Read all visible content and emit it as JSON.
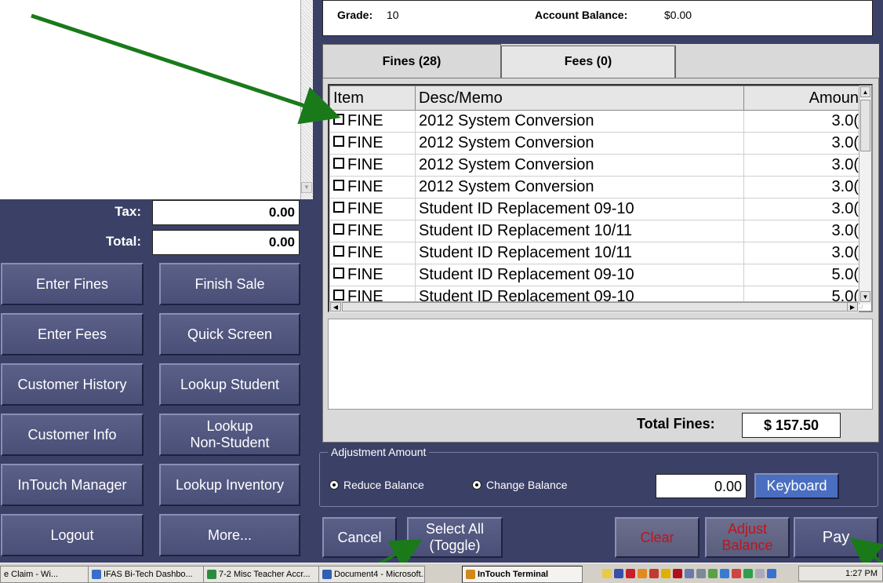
{
  "student_info": {
    "grade_label": "Grade:",
    "grade_value": "10",
    "balance_label": "Account Balance:",
    "balance_value": "$0.00"
  },
  "summary": {
    "tax_label": "Tax:",
    "tax_value": "0.00",
    "total_label": "Total:",
    "total_value": "0.00"
  },
  "left_buttons": {
    "enter_fines": "Enter Fines",
    "finish_sale": "Finish Sale",
    "enter_fees": "Enter Fees",
    "quick_screen": "Quick Screen",
    "customer_history": "Customer History",
    "lookup_student": "Lookup Student",
    "customer_info": "Customer Info",
    "lookup_non_student_1": "Lookup",
    "lookup_non_student_2": "Non-Student",
    "intouch_manager": "InTouch Manager",
    "lookup_inventory": "Lookup Inventory",
    "logout": "Logout",
    "more": "More..."
  },
  "tabs": [
    {
      "label": "Fines (28)",
      "active": true
    },
    {
      "label": "Fees (0)",
      "active": false
    }
  ],
  "grid": {
    "columns": [
      "Item",
      "Desc/Memo",
      "Amoun"
    ],
    "rows": [
      {
        "item": "FINE",
        "desc": "2012 System Conversion",
        "amount": "3.0("
      },
      {
        "item": "FINE",
        "desc": "2012 System Conversion",
        "amount": "3.0("
      },
      {
        "item": "FINE",
        "desc": "2012 System Conversion",
        "amount": "3.0("
      },
      {
        "item": "FINE",
        "desc": "2012 System Conversion",
        "amount": "3.0("
      },
      {
        "item": "FINE",
        "desc": "Student ID Replacement 09-10",
        "amount": "3.0("
      },
      {
        "item": "FINE",
        "desc": "Student ID Replacement 10/11",
        "amount": "3.0("
      },
      {
        "item": "FINE",
        "desc": "Student ID Replacement 10/11",
        "amount": "3.0("
      },
      {
        "item": "FINE",
        "desc": "Student ID Replacement 09-10",
        "amount": "5.0("
      },
      {
        "item": "FINE",
        "desc": "Student ID Replacement 09-10",
        "amount": "5.0("
      }
    ]
  },
  "totals": {
    "total_fines_label": "Total Fines:",
    "total_fines_value": "$ 157.50"
  },
  "adjustment": {
    "legend": "Adjustment Amount",
    "reduce_label": "Reduce Balance",
    "change_label": "Change Balance",
    "amount_value": "0.00",
    "keyboard_label": "Keyboard"
  },
  "bottom_buttons": {
    "cancel": "Cancel",
    "select_all_1": "Select All",
    "select_all_2": "(Toggle)",
    "clear": "Clear",
    "adjust_1": "Adjust",
    "adjust_2": "Balance",
    "pay": "Pay"
  },
  "taskbar": {
    "tasks": [
      "e Claim - Wi...",
      "IFAS Bi-Tech Dashbo...",
      "7-2 Misc Teacher Accr...",
      "Document4 - Microsoft...",
      "InTouch Terminal"
    ],
    "clock": "1:27 PM"
  },
  "colors": {
    "panel_bg": "#3b4066",
    "arrow_green": "#1a7a1a",
    "clear_red": "#c0141e"
  }
}
